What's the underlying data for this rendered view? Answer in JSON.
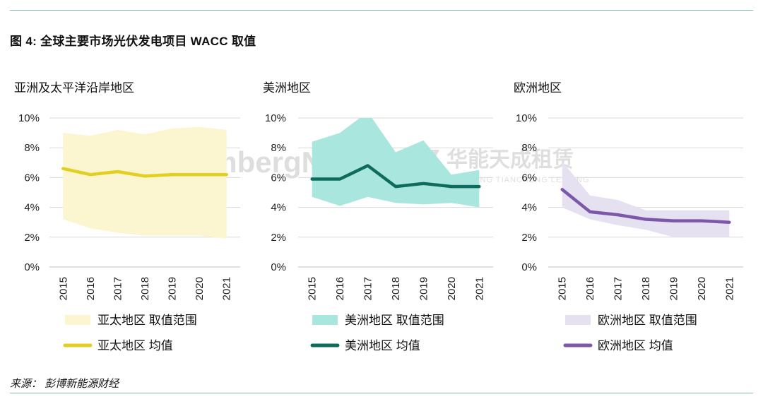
{
  "figure": {
    "title": "图 4:  全球主要市场光伏发电项目 WACC 取值",
    "source": "来源：  彭博新能源财经"
  },
  "watermark": {
    "bloomberg": "BloombergNEF",
    "company": "华能天成租赁",
    "company_en": "HUANENG TIANCHENG LEASING",
    "color": "#d4d4d4"
  },
  "chart_data": [
    {
      "type": "area",
      "title": "亚洲及太平洋沿岸地区",
      "categories": [
        "2015",
        "2016",
        "2017",
        "2018",
        "2019",
        "2020",
        "2021"
      ],
      "ylim": [
        0,
        10
      ],
      "yticks": [
        "0%",
        "2%",
        "4%",
        "6%",
        "8%",
        "10%"
      ],
      "grid": true,
      "legend_position": "bottom",
      "series": [
        {
          "name": "亚太地区 取值范围",
          "kind": "range",
          "color": "#fbf6cf",
          "low": [
            3.2,
            2.6,
            2.3,
            2.1,
            2.1,
            2.1,
            1.9
          ],
          "high": [
            9.0,
            8.8,
            9.2,
            8.9,
            9.3,
            9.4,
            9.2
          ]
        },
        {
          "name": "亚太地区 均值",
          "kind": "line",
          "color": "#e2cf21",
          "values": [
            6.6,
            6.2,
            6.4,
            6.1,
            6.2,
            6.2,
            6.2
          ]
        }
      ]
    },
    {
      "type": "area",
      "title": "美洲地区",
      "categories": [
        "2015",
        "2016",
        "2017",
        "2018",
        "2019",
        "2020",
        "2021"
      ],
      "ylim": [
        0,
        10
      ],
      "yticks": [
        "0%",
        "2%",
        "4%",
        "6%",
        "8%",
        "10%"
      ],
      "grid": true,
      "legend_position": "bottom",
      "series": [
        {
          "name": "美洲地区 取值范围",
          "kind": "range",
          "color": "#a8e6de",
          "low": [
            4.7,
            4.1,
            4.7,
            4.3,
            4.2,
            4.3,
            4.0
          ],
          "high": [
            8.4,
            9.0,
            10.4,
            7.7,
            8.5,
            6.2,
            6.5
          ]
        },
        {
          "name": "美洲地区 均值",
          "kind": "line",
          "color": "#0f6b5c",
          "values": [
            5.9,
            5.9,
            6.8,
            5.4,
            5.6,
            5.4,
            5.4
          ]
        }
      ]
    },
    {
      "type": "area",
      "title": "欧洲地区",
      "categories": [
        "2015",
        "2016",
        "2017",
        "2018",
        "2019",
        "2020",
        "2021"
      ],
      "ylim": [
        0,
        10
      ],
      "yticks": [
        "0%",
        "2%",
        "4%",
        "6%",
        "8%",
        "10%"
      ],
      "grid": true,
      "legend_position": "bottom",
      "series": [
        {
          "name": "欧洲地区 取值范围",
          "kind": "range",
          "color": "#e6e1f0",
          "low": [
            4.0,
            3.2,
            2.8,
            2.5,
            2.0,
            2.0,
            2.0
          ],
          "high": [
            7.1,
            4.8,
            4.5,
            3.8,
            3.8,
            3.8,
            3.8
          ]
        },
        {
          "name": "欧洲地区 均值",
          "kind": "line",
          "color": "#7e58a8",
          "values": [
            5.2,
            3.7,
            3.5,
            3.2,
            3.1,
            3.1,
            3.0
          ]
        }
      ]
    }
  ]
}
